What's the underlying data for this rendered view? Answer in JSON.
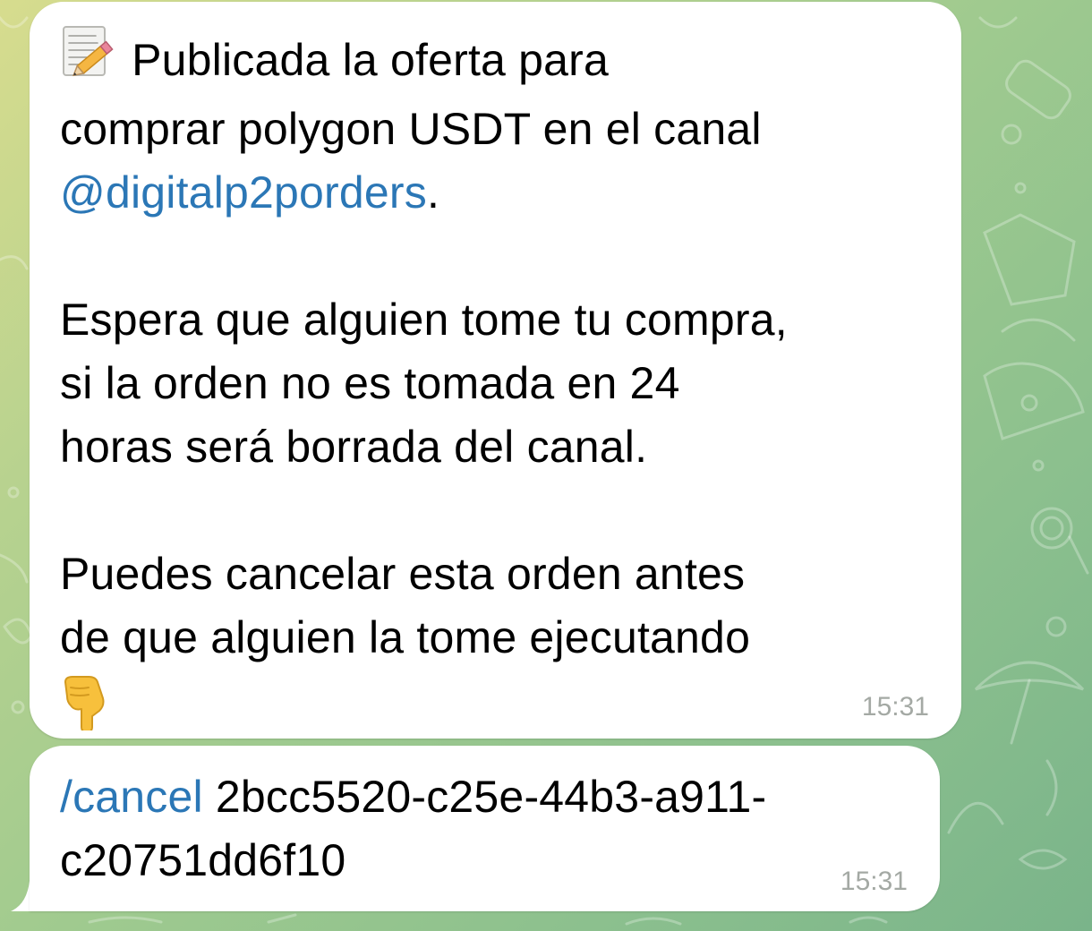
{
  "messages": [
    {
      "emoji_start": "memo-icon",
      "line1": "Publicada la oferta para",
      "line2_prefix": "comprar polygon USDT en el canal",
      "channel_link": "@digitalp2porders",
      "channel_suffix": ".",
      "para2": "Espera que alguien tome tu compra,\nsi la orden no es tomada en 24\nhoras será borrada del canal.",
      "para3": "Puedes cancelar esta orden antes\nde que alguien la tome ejecutando",
      "emoji_end": "pointing-down-icon",
      "time": "15:31"
    },
    {
      "command": "/cancel",
      "order_id_part1": " 2bcc5520-c25e-44b3-a911-",
      "order_id_part2": "c20751dd6f10",
      "time": "15:31"
    }
  ],
  "colors": {
    "link": "#2b77b6",
    "bubble": "#ffffff",
    "time": "#a4a9a4"
  }
}
